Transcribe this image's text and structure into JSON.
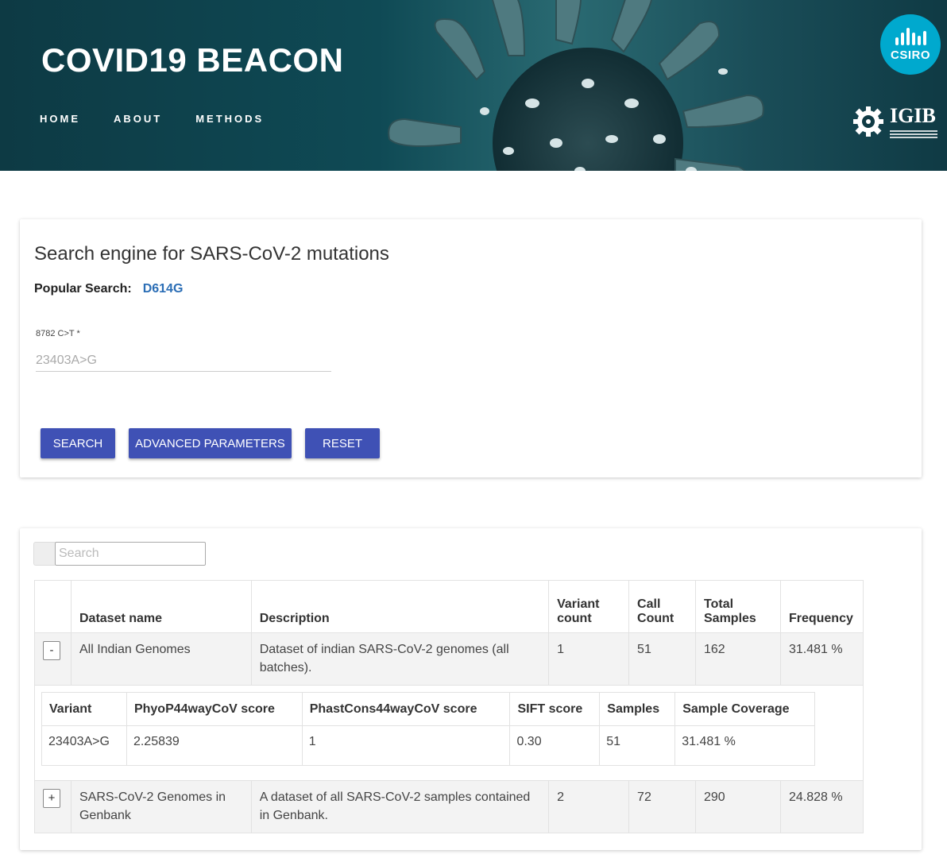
{
  "header": {
    "title": "COVID19 BEACON",
    "nav": [
      "HOME",
      "ABOUT",
      "METHODS"
    ],
    "logo_csiro": "CSIRO",
    "logo_igib": "IGIB",
    "icons": [
      "csiro-logo-icon",
      "igib-gear-icon",
      "virus-illustration"
    ]
  },
  "search_card": {
    "title": "Search engine for SARS-CoV-2 mutations",
    "popular_label": "Popular Search:",
    "popular_link": "D614G",
    "field_label": "8782 C>T *",
    "field_placeholder": "23403A>G",
    "buttons": {
      "search": "SEARCH",
      "advanced": "ADVANCED PARAMETERS",
      "reset": "RESET"
    }
  },
  "results": {
    "search_placeholder": "Search",
    "columns": [
      "",
      "Dataset name",
      "Description",
      "Variant count",
      "Call Count",
      "Total Samples",
      "Frequency"
    ],
    "column_lines": {
      "variant_count": [
        "Variant",
        "count"
      ],
      "call_count": [
        "Call",
        "Count"
      ],
      "total_samples": [
        "Total",
        "Samples"
      ]
    },
    "rows": [
      {
        "toggle": "-",
        "dataset": "All Indian Genomes",
        "description": "Dataset of indian SARS-CoV-2 genomes (all batches).",
        "variant_count": "1",
        "call_count": "51",
        "total_samples": "162",
        "frequency": "31.481 %"
      },
      {
        "toggle": "+",
        "dataset": "SARS-CoV-2 Genomes in Genbank",
        "description": "A dataset of all SARS-CoV-2 samples contained in Genbank.",
        "variant_count": "2",
        "call_count": "72",
        "total_samples": "290",
        "frequency": "24.828 %"
      }
    ],
    "sub_table": {
      "columns": [
        "Variant",
        "PhyoP44wayCoV score",
        "PhastCons44wayCoV score",
        "SIFT score",
        "Samples",
        "Sample Coverage"
      ],
      "row": [
        "23403A>G",
        "2.25839",
        "1",
        "0.30",
        "51",
        "31.481 %"
      ]
    }
  },
  "colors": {
    "header_bg": "#0f4a55",
    "button": "#3f51b5",
    "link": "#2a6db5",
    "csiro": "#00a9ce"
  }
}
